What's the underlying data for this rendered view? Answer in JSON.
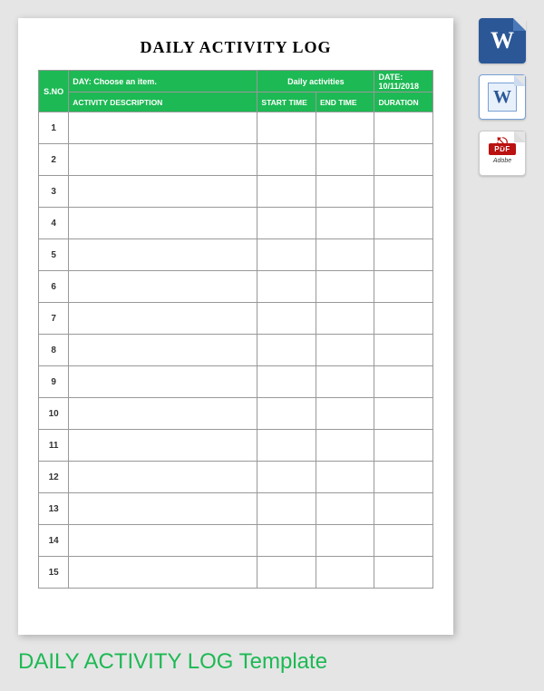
{
  "document": {
    "title": "DAILY ACTIVITY LOG",
    "header": {
      "sno": "S.NO",
      "day_label": "DAY:  Choose an item.",
      "center": "Daily activities",
      "date_label": "DATE: 10/11/2018"
    },
    "columns": {
      "desc": "ACTIVITY DESCRIPTION",
      "start": "START TIME",
      "end": "END TIME",
      "duration": "DURATION"
    },
    "rows": [
      {
        "n": "1",
        "desc": "",
        "start": "",
        "end": "",
        "dur": ""
      },
      {
        "n": "2",
        "desc": "",
        "start": "",
        "end": "",
        "dur": ""
      },
      {
        "n": "3",
        "desc": "",
        "start": "",
        "end": "",
        "dur": ""
      },
      {
        "n": "4",
        "desc": "",
        "start": "",
        "end": "",
        "dur": ""
      },
      {
        "n": "5",
        "desc": "",
        "start": "",
        "end": "",
        "dur": ""
      },
      {
        "n": "6",
        "desc": "",
        "start": "",
        "end": "",
        "dur": ""
      },
      {
        "n": "7",
        "desc": "",
        "start": "",
        "end": "",
        "dur": ""
      },
      {
        "n": "8",
        "desc": "",
        "start": "",
        "end": "",
        "dur": ""
      },
      {
        "n": "9",
        "desc": "",
        "start": "",
        "end": "",
        "dur": ""
      },
      {
        "n": "10",
        "desc": "",
        "start": "",
        "end": "",
        "dur": ""
      },
      {
        "n": "11",
        "desc": "",
        "start": "",
        "end": "",
        "dur": ""
      },
      {
        "n": "12",
        "desc": "",
        "start": "",
        "end": "",
        "dur": ""
      },
      {
        "n": "13",
        "desc": "",
        "start": "",
        "end": "",
        "dur": ""
      },
      {
        "n": "14",
        "desc": "",
        "start": "",
        "end": "",
        "dur": ""
      },
      {
        "n": "15",
        "desc": "",
        "start": "",
        "end": "",
        "dur": ""
      }
    ]
  },
  "caption": "DAILY ACTIVITY LOG Template",
  "downloads": {
    "word_new": "W",
    "word_old": "W",
    "pdf_label": "PDF",
    "pdf_brand": "Adobe"
  }
}
